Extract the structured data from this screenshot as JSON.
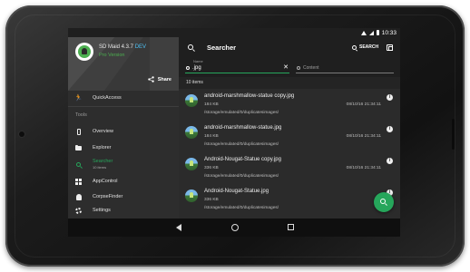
{
  "status_bar": {
    "time": "10:33"
  },
  "drawer": {
    "app_name": "SD Maid 4.3.7",
    "app_dev_tag": "DEV",
    "app_edition": "Pro Version",
    "share_label": "Share",
    "section_tools": "Tools",
    "items": [
      {
        "label": "QuickAccess",
        "icon": "run-icon"
      },
      {
        "label": "Overview",
        "icon": "phone-icon"
      },
      {
        "label": "Explorer",
        "icon": "folder-icon"
      },
      {
        "label": "Searcher",
        "sublabel": "10 items",
        "icon": "search-icon",
        "active": true
      },
      {
        "label": "AppControl",
        "icon": "grid-icon"
      },
      {
        "label": "CorpseFinder",
        "icon": "ghost-icon"
      },
      {
        "label": "Settings",
        "icon": "gear-icon"
      }
    ]
  },
  "toolbar": {
    "title": "Searcher",
    "search_action": "SEARCH"
  },
  "filters": {
    "name_label": "Name",
    "name_value": ".jpg",
    "content_placeholder": "Content"
  },
  "results": {
    "count_text": "10 items",
    "items": [
      {
        "name": "android-marshmallow-statue copy.jpg",
        "size": "184 KB",
        "date": "08/10/16 21:34:11",
        "path": "/storage/emulated/0/duplicatesimages/"
      },
      {
        "name": "android-marshmallow-statue.jpg",
        "size": "184 KB",
        "date": "08/10/16 21:34:11",
        "path": "/storage/emulated/0/duplicatesimages/"
      },
      {
        "name": "Android-Nougat-Statue copy.jpg",
        "size": "336 KB",
        "date": "08/10/16 21:34:11",
        "path": "/storage/emulated/0/duplicatesimages/"
      },
      {
        "name": "Android-Nougat-Statue.jpg",
        "size": "336 KB",
        "date": "08/10/16 21:34:11",
        "path": "/storage/emulated/0/duplicatesimages/"
      }
    ]
  },
  "colors": {
    "accent": "#26a65b",
    "dev_tag": "#4fc3f7"
  }
}
